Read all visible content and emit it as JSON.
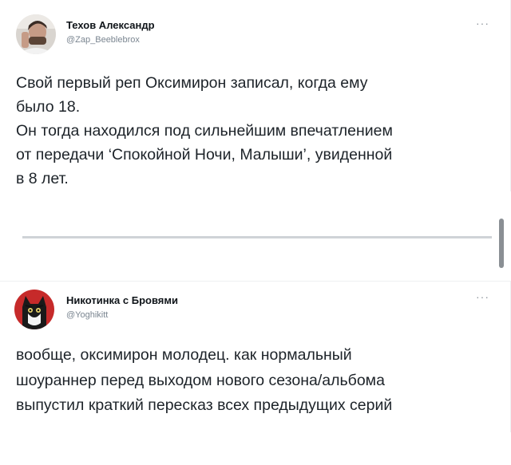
{
  "tweets": [
    {
      "author_name": "Техов Александр",
      "handle": "@Zap_Beeblebrox",
      "more_label": "···",
      "text_lines": [
        "Свой первый реп Оксимирон записал, когда ему",
        "было 18.",
        "Он тогда находился под сильнейшим впечатлением",
        "от передачи ‘Спокойной Ночи, Малыши’, увиденной",
        "в 8 лет."
      ]
    },
    {
      "author_name": "Никотинка с Бровями",
      "handle": "@Yoghikitt",
      "more_label": "···",
      "text_lines": [
        "вообще, оксимирон молодец. как нормальный",
        "шоураннер перед выходом нового сезона/альбома",
        "выпустил краткий пересказ всех предыдущих серий"
      ]
    }
  ],
  "colors": {
    "text": "#1d2329",
    "muted": "#7a8590",
    "divider": "#cfd3d7",
    "scrollbar": "#8a8f94"
  }
}
